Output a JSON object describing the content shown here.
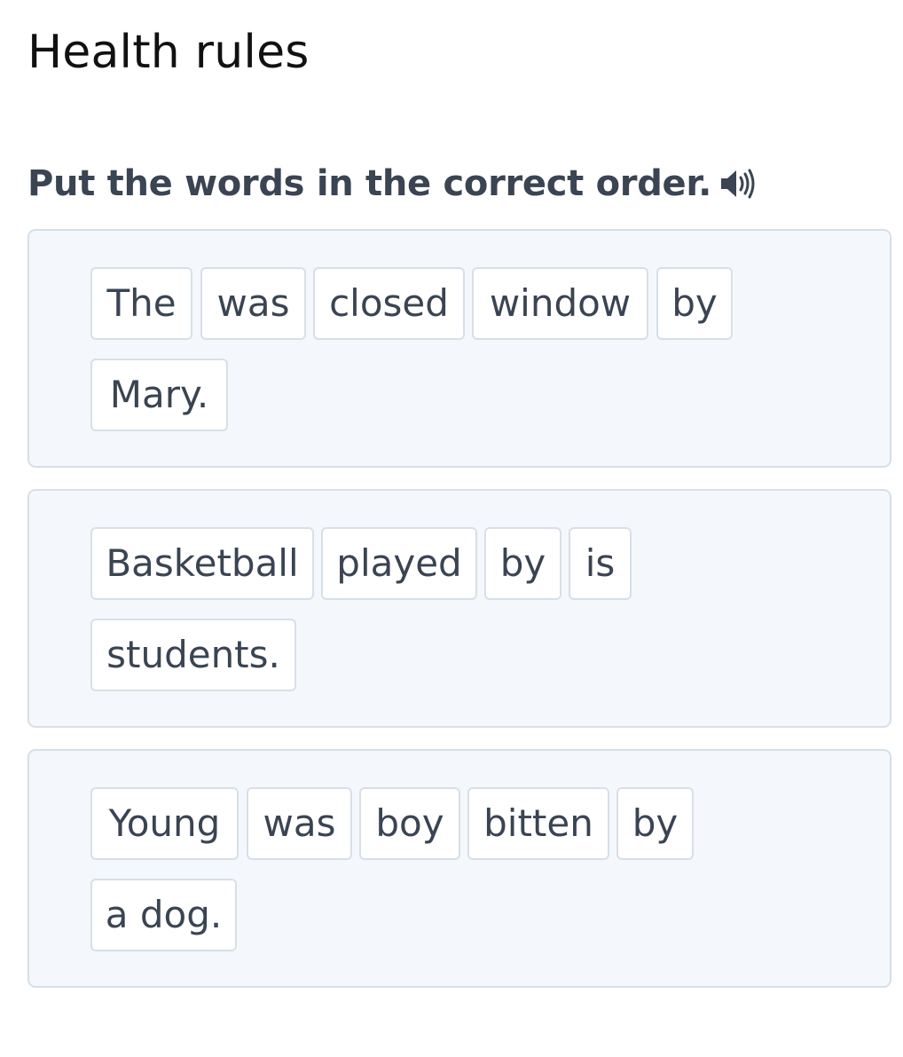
{
  "page": {
    "title": "Health rules",
    "instruction": "Put the words in the correct order."
  },
  "icons": {
    "audio": "speaker-icon"
  },
  "colors": {
    "text": "#3a4452",
    "title": "#111111",
    "panel_background": "#f4f8fc",
    "border": "#d7dfe7",
    "tile_background": "#ffffff"
  },
  "exercises": [
    {
      "words": [
        "The",
        "was",
        "closed",
        "window",
        "by",
        "Mary."
      ]
    },
    {
      "words": [
        "Basketball",
        "played",
        "by",
        "is",
        "students."
      ]
    },
    {
      "words": [
        "Young",
        "was",
        "boy",
        "bitten",
        "by",
        "a dog."
      ]
    }
  ]
}
